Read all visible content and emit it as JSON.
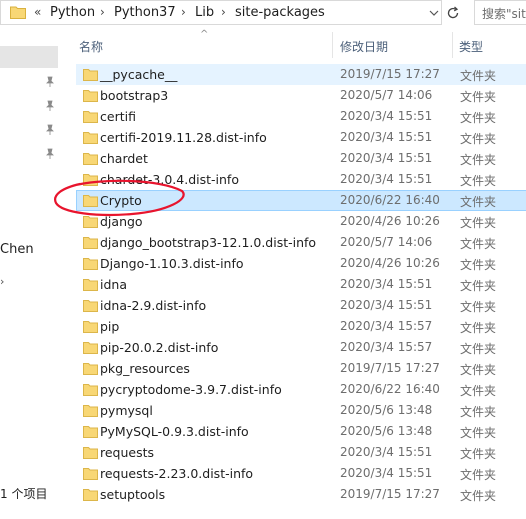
{
  "address_bar": {
    "overflow": "«",
    "crumbs": [
      "Python",
      "Python37",
      "Lib",
      "site-packages"
    ],
    "separator": "›"
  },
  "search": {
    "placeholder": "搜索\"site"
  },
  "nav_pane": {
    "user_label": "Chen",
    "status": "1 个项目"
  },
  "columns": {
    "name": "名称",
    "date": "修改日期",
    "type": "类型"
  },
  "files": [
    {
      "name": "__pycache__",
      "date": "2019/7/15 17:27",
      "type": "文件夹",
      "highlight": "light"
    },
    {
      "name": "bootstrap3",
      "date": "2020/5/7 14:06",
      "type": "文件夹"
    },
    {
      "name": "certifi",
      "date": "2020/3/4 15:51",
      "type": "文件夹"
    },
    {
      "name": "certifi-2019.11.28.dist-info",
      "date": "2020/3/4 15:51",
      "type": "文件夹"
    },
    {
      "name": "chardet",
      "date": "2020/3/4 15:51",
      "type": "文件夹"
    },
    {
      "name": "chardet-3.0.4.dist-info",
      "date": "2020/3/4 15:51",
      "type": "文件夹"
    },
    {
      "name": "Crypto",
      "date": "2020/6/22 16:40",
      "type": "文件夹",
      "highlight": "selected"
    },
    {
      "name": "django",
      "date": "2020/4/26 10:26",
      "type": "文件夹"
    },
    {
      "name": "django_bootstrap3-12.1.0.dist-info",
      "date": "2020/5/7 14:06",
      "type": "文件夹"
    },
    {
      "name": "Django-1.10.3.dist-info",
      "date": "2020/4/26 10:26",
      "type": "文件夹"
    },
    {
      "name": "idna",
      "date": "2020/3/4 15:51",
      "type": "文件夹"
    },
    {
      "name": "idna-2.9.dist-info",
      "date": "2020/3/4 15:51",
      "type": "文件夹"
    },
    {
      "name": "pip",
      "date": "2020/3/4 15:57",
      "type": "文件夹"
    },
    {
      "name": "pip-20.0.2.dist-info",
      "date": "2020/3/4 15:57",
      "type": "文件夹"
    },
    {
      "name": "pkg_resources",
      "date": "2019/7/15 17:27",
      "type": "文件夹"
    },
    {
      "name": "pycryptodome-3.9.7.dist-info",
      "date": "2020/6/22 16:40",
      "type": "文件夹"
    },
    {
      "name": "pymysql",
      "date": "2020/5/6 13:48",
      "type": "文件夹"
    },
    {
      "name": "PyMySQL-0.9.3.dist-info",
      "date": "2020/5/6 13:48",
      "type": "文件夹"
    },
    {
      "name": "requests",
      "date": "2020/3/4 15:51",
      "type": "文件夹"
    },
    {
      "name": "requests-2.23.0.dist-info",
      "date": "2020/3/4 15:51",
      "type": "文件夹"
    },
    {
      "name": "setuptools",
      "date": "2019/7/15 17:27",
      "type": "文件夹"
    }
  ],
  "colors": {
    "folder": "#f8d775",
    "selection_bg": "#cce8ff",
    "hover_bg": "#e5f3ff",
    "annotation": "#e8142d"
  }
}
